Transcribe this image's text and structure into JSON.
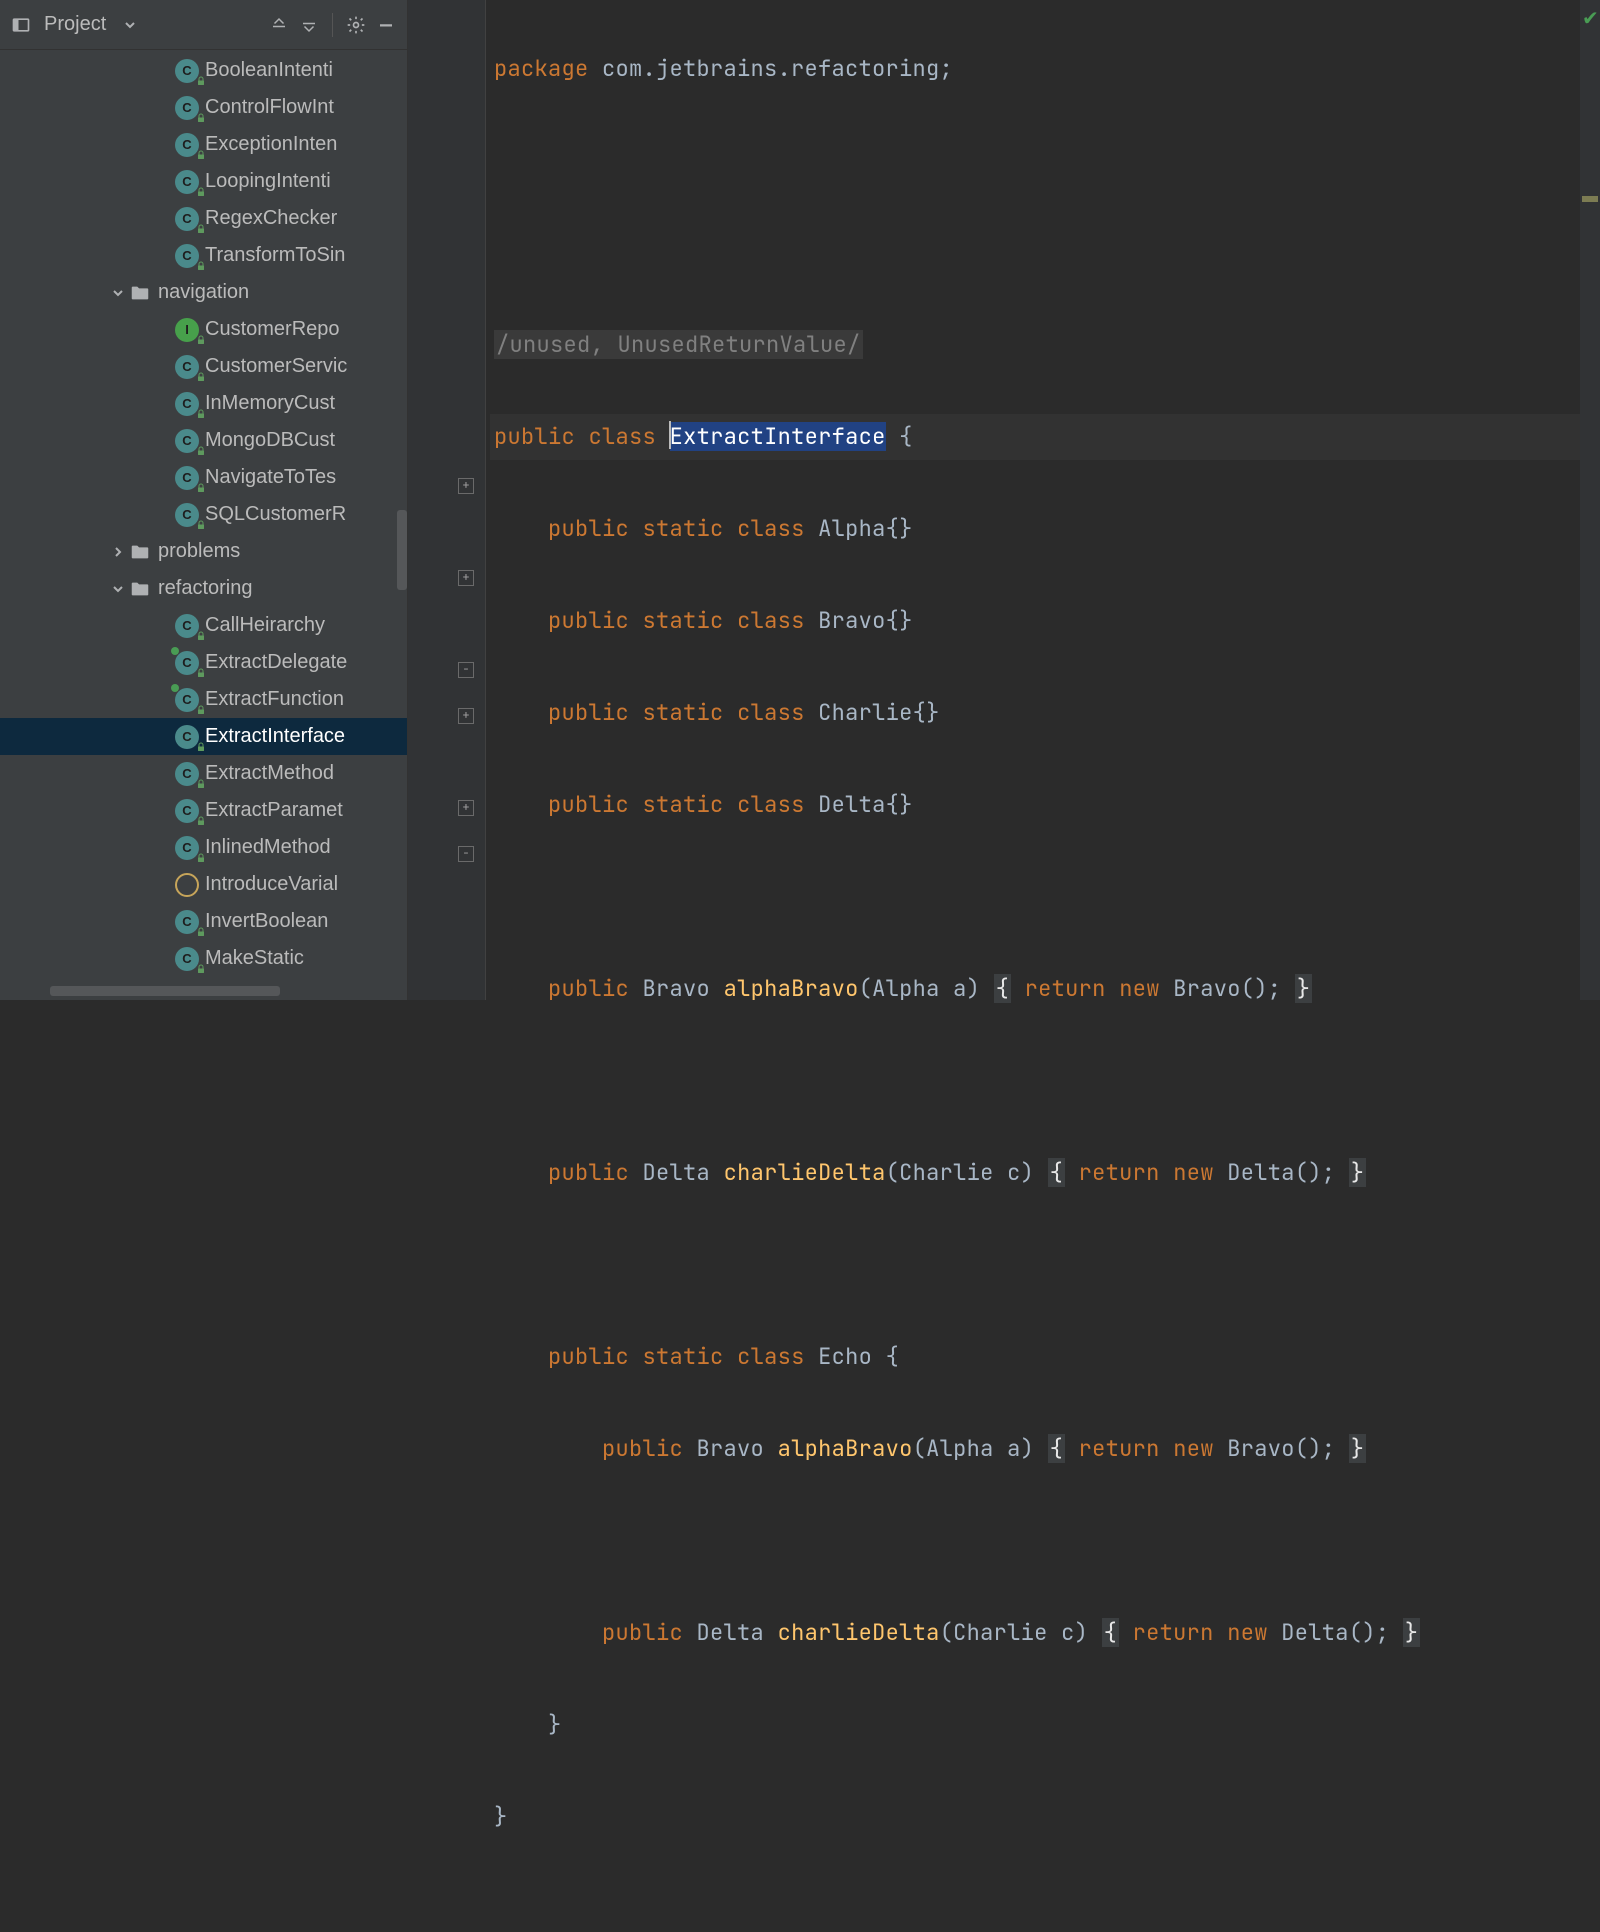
{
  "project": {
    "title": "Project",
    "tree": [
      {
        "indent": 175,
        "icon": "class",
        "label": "BooleanIntenti"
      },
      {
        "indent": 175,
        "icon": "class",
        "label": "ControlFlowInt"
      },
      {
        "indent": 175,
        "icon": "class",
        "label": "ExceptionInten"
      },
      {
        "indent": 175,
        "icon": "class",
        "label": "LoopingIntenti"
      },
      {
        "indent": 175,
        "icon": "class",
        "label": "RegexChecker"
      },
      {
        "indent": 175,
        "icon": "class",
        "label": "TransformToSin"
      },
      {
        "indent": 108,
        "icon": "folder",
        "label": "navigation",
        "expand": "open"
      },
      {
        "indent": 175,
        "icon": "interface",
        "label": "CustomerRepo"
      },
      {
        "indent": 175,
        "icon": "class",
        "label": "CustomerServic"
      },
      {
        "indent": 175,
        "icon": "class",
        "label": "InMemoryCust"
      },
      {
        "indent": 175,
        "icon": "class",
        "label": "MongoDBCust"
      },
      {
        "indent": 175,
        "icon": "class",
        "label": "NavigateToTes"
      },
      {
        "indent": 175,
        "icon": "class",
        "label": "SQLCustomerR"
      },
      {
        "indent": 108,
        "icon": "folder",
        "label": "problems",
        "expand": "closed"
      },
      {
        "indent": 108,
        "icon": "folder",
        "label": "refactoring",
        "expand": "open"
      },
      {
        "indent": 175,
        "icon": "class",
        "label": "CallHeirarchy"
      },
      {
        "indent": 175,
        "icon": "class",
        "label": "ExtractDelegate",
        "mod": true
      },
      {
        "indent": 175,
        "icon": "class",
        "label": "ExtractFunction",
        "mod": true
      },
      {
        "indent": 175,
        "icon": "class",
        "label": "ExtractInterface",
        "selected": true
      },
      {
        "indent": 175,
        "icon": "class",
        "label": "ExtractMethod"
      },
      {
        "indent": 175,
        "icon": "class",
        "label": "ExtractParamet"
      },
      {
        "indent": 175,
        "icon": "class",
        "label": "InlinedMethod"
      },
      {
        "indent": 175,
        "icon": "field",
        "label": "IntroduceVarial"
      },
      {
        "indent": 175,
        "icon": "class",
        "label": "InvertBoolean"
      },
      {
        "indent": 175,
        "icon": "class",
        "label": "MakeStatic"
      }
    ]
  },
  "comment_text": "/unused, UnusedReturnValue/",
  "package_kw": "package",
  "package_name": " com.jetbrains.refactoring;",
  "public_kw": "public",
  "class_kw": "class",
  "static_kw": "static",
  "return_kw": "return",
  "new_kw": "new",
  "classname_E": "E",
  "classname_rest": "xtractInterface",
  "inner": {
    "alpha": "Alpha",
    "bravo": "Bravo",
    "charlie": "Charlie",
    "delta": "Delta",
    "echo": "Echo"
  },
  "methods": {
    "alphaBravo": "alphaBravo",
    "charlieDelta": "charlieDelta"
  },
  "sig": {
    "alphaBravo_args": "(Alpha a)",
    "charlieDelta_args": "(Charlie c)",
    "bravo_ctor": "Bravo();",
    "delta_ctor": "Delta();"
  }
}
